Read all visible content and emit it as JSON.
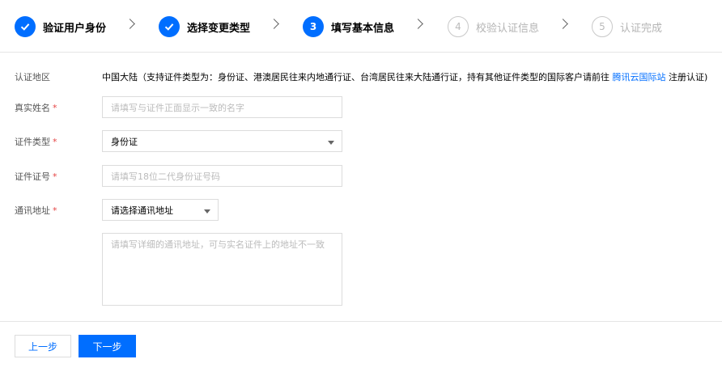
{
  "steps": [
    {
      "number": "1",
      "label": "验证用户身份",
      "state": "done"
    },
    {
      "number": "2",
      "label": "选择变更类型",
      "state": "done"
    },
    {
      "number": "3",
      "label": "填写基本信息",
      "state": "active"
    },
    {
      "number": "4",
      "label": "校验认证信息",
      "state": "pending"
    },
    {
      "number": "5",
      "label": "认证完成",
      "state": "pending"
    }
  ],
  "form": {
    "region_label": "认证地区",
    "region_value": "中国大陆（支持证件类型为：身份证、港澳居民往来内地通行证、台湾居民往来大陆通行证，持有其他证件类型的国际客户请前往 ",
    "region_link": "腾讯云国际站",
    "region_suffix": " 注册认证)",
    "name_label": "真实姓名",
    "name_placeholder": "请填写与证件正面显示一致的名字",
    "id_type_label": "证件类型",
    "id_type_value": "身份证",
    "id_number_label": "证件证号",
    "id_number_placeholder": "请填写18位二代身份证号码",
    "address_label": "通讯地址",
    "address_select_value": "请选择通讯地址",
    "address_detail_placeholder": "请填写详细的通讯地址，可与实名证件上的地址不一致",
    "required_mark": "*"
  },
  "buttons": {
    "prev": "上一步",
    "next": "下一步"
  },
  "colors": {
    "primary": "#006eff",
    "required": "#e54545",
    "muted": "#b4b4b4"
  }
}
